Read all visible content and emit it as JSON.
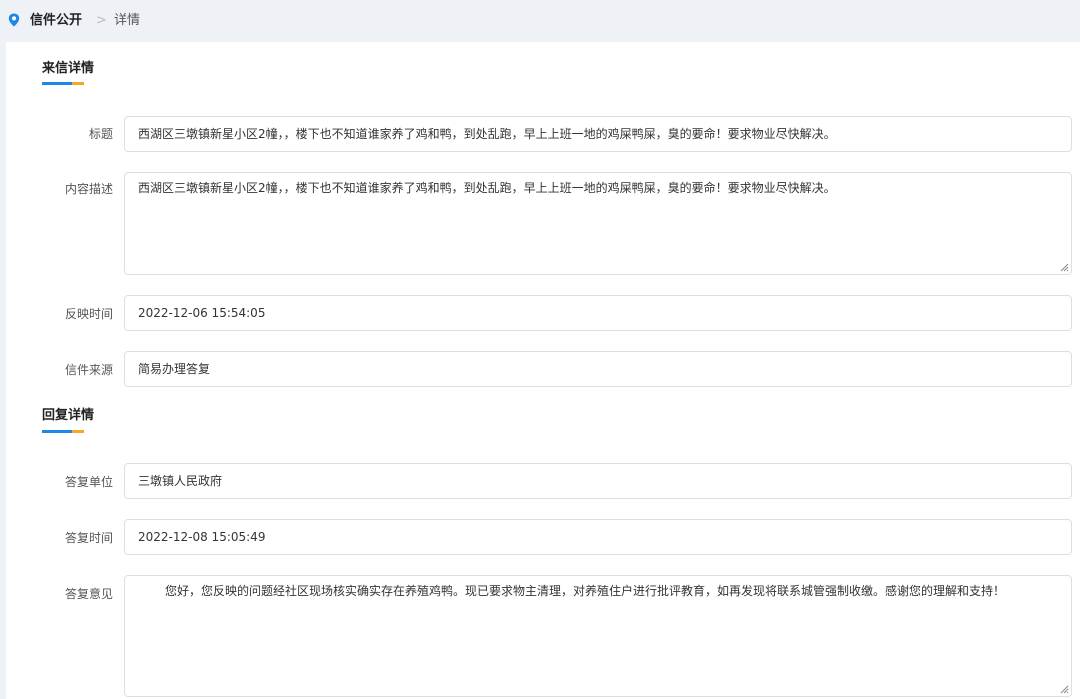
{
  "breadcrumb": {
    "icon": "location-pin-icon",
    "root": "信件公开",
    "separator": ">",
    "current": "详情"
  },
  "letter_section": {
    "title": "来信详情",
    "fields": {
      "title_label": "标题",
      "title_value": "西湖区三墩镇新星小区2幢，，楼下也不知道谁家养了鸡和鸭，到处乱跑，早上上班一地的鸡屎鸭屎，臭的要命！要求物业尽快解决。",
      "content_label": "内容描述",
      "content_value": "西湖区三墩镇新星小区2幢，，楼下也不知道谁家养了鸡和鸭，到处乱跑，早上上班一地的鸡屎鸭屎，臭的要命！要求物业尽快解决。",
      "time_label": "反映时间",
      "time_value": "2022-12-06 15:54:05",
      "source_label": "信件来源",
      "source_value": "简易办理答复"
    }
  },
  "reply_section": {
    "title": "回复详情",
    "fields": {
      "unit_label": "答复单位",
      "unit_value": "三墩镇人民政府",
      "time_label": "答复时间",
      "time_value": "2022-12-08 15:05:49",
      "opinion_label": "答复意见",
      "opinion_value": "您好，您反映的问题经社区现场核实确实存在养殖鸡鸭。现已要求物主清理，对养殖住户进行批评教育，如再发现将联系城管强制收缴。感谢您的理解和支持！"
    }
  },
  "colors": {
    "accent_blue": "#1e88e5",
    "accent_orange": "#f5a623",
    "page_bg": "#eef2f7"
  }
}
